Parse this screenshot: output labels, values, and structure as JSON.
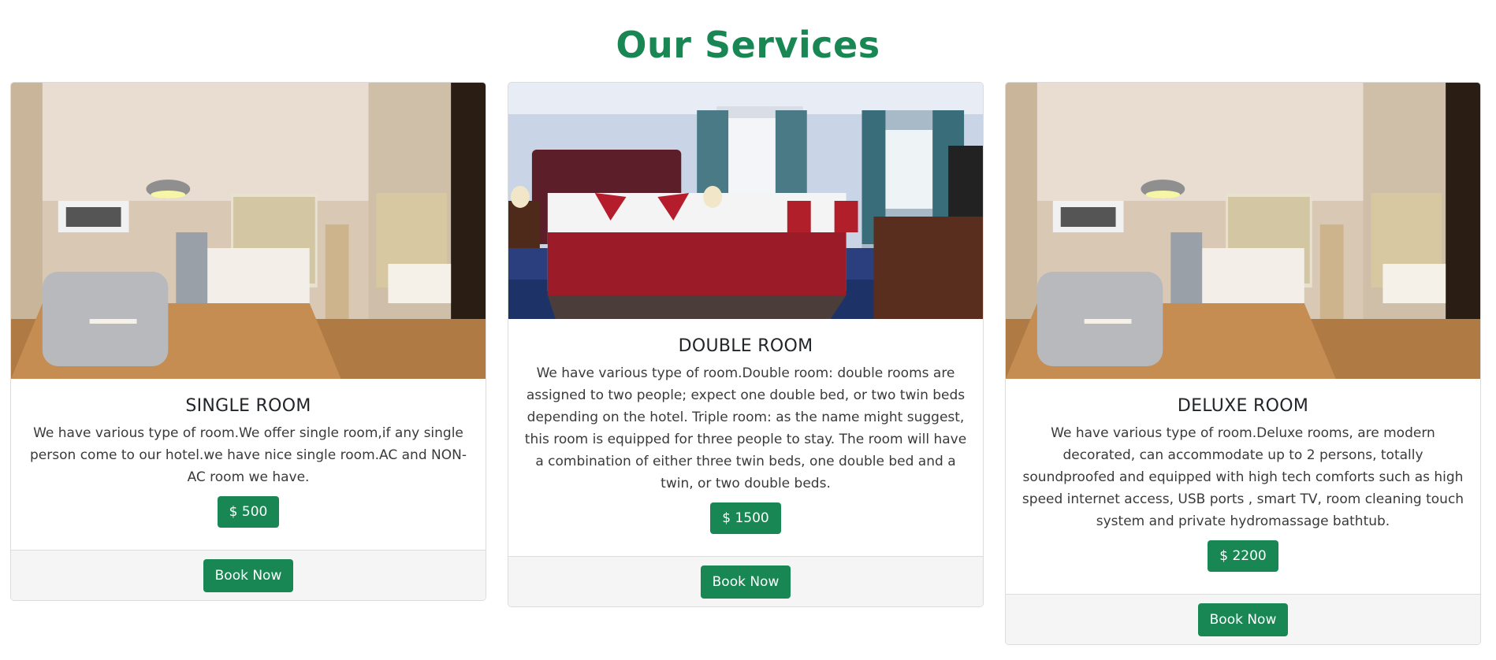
{
  "section": {
    "title": "Our Services"
  },
  "rooms": [
    {
      "title": "SINGLE ROOM",
      "description": "We have various type of room.We offer single room,if any single person come to our hotel.we have nice single room.AC and NON-AC room we have.",
      "price": "$ 500",
      "book_label": "Book Now",
      "image": "room-photo"
    },
    {
      "title": "DOUBLE ROOM",
      "description": "We have various type of room.Double room: double rooms are assigned to two people; expect one double bed, or two twin beds depending on the hotel. Triple room: as the name might suggest, this room is equipped for three people to stay. The room will have a combination of either three twin beds, one double bed and a twin, or two double beds.",
      "price": "$ 1500",
      "book_label": "Book Now",
      "image": "room-photo"
    },
    {
      "title": "DELUXE ROOM",
      "description": "We have various type of room.Deluxe rooms, are modern decorated, can accommodate up to 2 persons, totally soundproofed and equipped with high tech comforts such as high speed internet access, USB ports , smart TV, room cleaning touch system and private hydromassage bathtub.",
      "price": "$ 2200",
      "book_label": "Book Now",
      "image": "room-photo"
    }
  ],
  "colors": {
    "accent": "#198754",
    "footer_bg": "#f5f5f5",
    "border": "#dcdcdc"
  }
}
